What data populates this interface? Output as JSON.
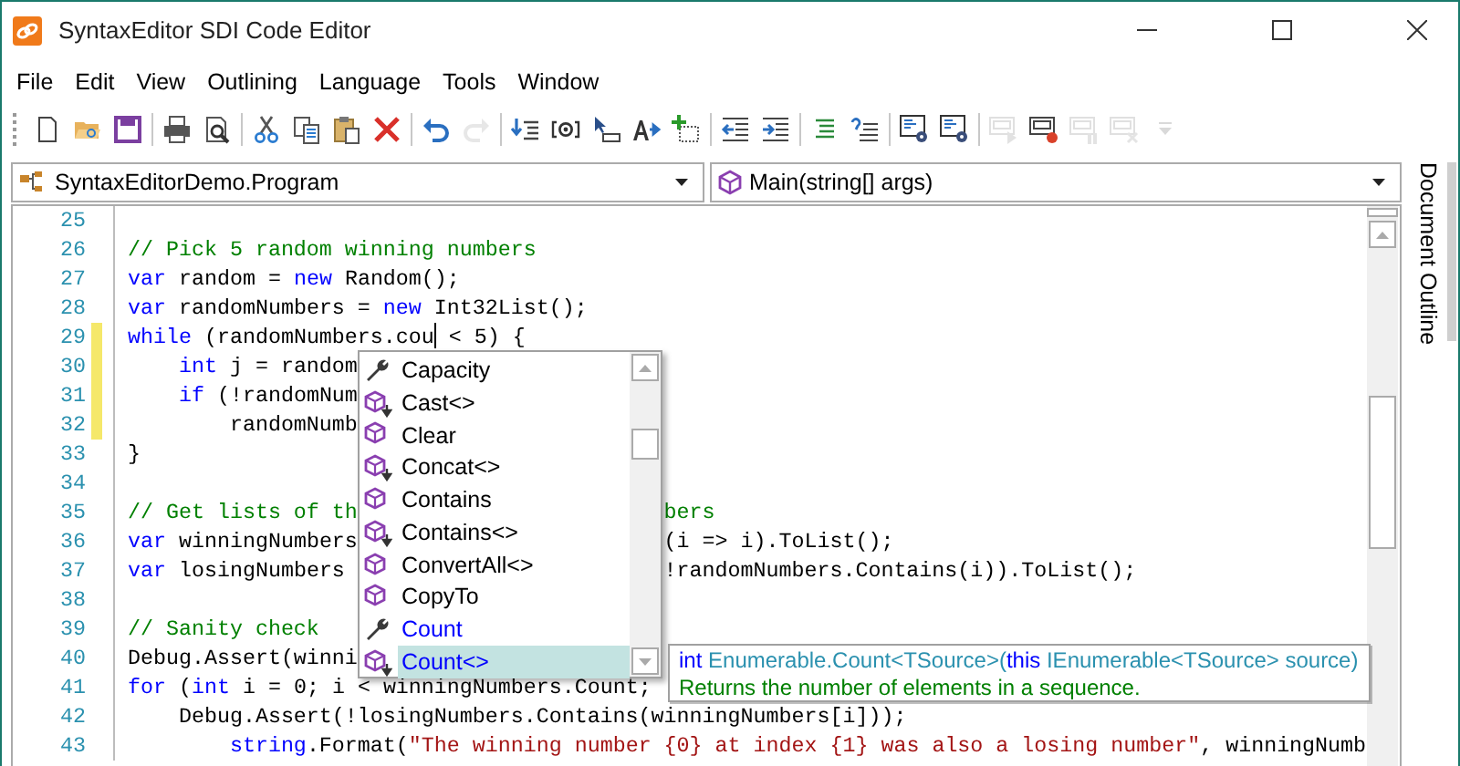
{
  "window": {
    "title": "SyntaxEditor SDI Code Editor"
  },
  "menu": [
    "File",
    "Edit",
    "View",
    "Outlining",
    "Language",
    "Tools",
    "Window"
  ],
  "toolbar": {
    "groups": [
      [
        {
          "kind": "new",
          "disabled": false
        },
        {
          "kind": "open",
          "disabled": false
        },
        {
          "kind": "save",
          "disabled": false
        }
      ],
      [
        {
          "kind": "print",
          "disabled": false
        },
        {
          "kind": "preview",
          "disabled": false
        }
      ],
      [
        {
          "kind": "cut",
          "disabled": false
        },
        {
          "kind": "copy",
          "disabled": false
        },
        {
          "kind": "paste",
          "disabled": false
        },
        {
          "kind": "delete",
          "disabled": false
        }
      ],
      [
        {
          "kind": "undo",
          "disabled": false
        },
        {
          "kind": "redo",
          "disabled": true
        }
      ],
      [
        {
          "kind": "list-arrow",
          "disabled": false
        },
        {
          "kind": "at-bracket",
          "disabled": false
        },
        {
          "kind": "pointer-box",
          "disabled": false
        },
        {
          "kind": "letter-arrow",
          "disabled": false
        },
        {
          "kind": "plus-box",
          "disabled": false
        }
      ],
      [
        {
          "kind": "outdent",
          "disabled": false
        },
        {
          "kind": "indent",
          "disabled": false
        }
      ],
      [
        {
          "kind": "lines",
          "disabled": false
        },
        {
          "kind": "lines-curl",
          "disabled": false
        }
      ],
      [
        {
          "kind": "doc-gear",
          "disabled": false
        },
        {
          "kind": "doc-gear",
          "disabled": false
        }
      ],
      [
        {
          "kind": "monitor-play",
          "disabled": true
        },
        {
          "kind": "monitor-record",
          "disabled": false
        },
        {
          "kind": "monitor-pause",
          "disabled": true
        },
        {
          "kind": "monitor-cross",
          "disabled": true
        },
        {
          "kind": "overflow",
          "disabled": true
        }
      ]
    ]
  },
  "type_combo": {
    "value": "SyntaxEditorDemo.Program"
  },
  "member_combo": {
    "value": "Main(string[] args)"
  },
  "side_tab": {
    "label": "Document Outline"
  },
  "editor": {
    "lines": [
      {
        "number": "25",
        "modified": false
      },
      {
        "number": "26",
        "modified": false,
        "tokens": [
          {
            "kind": "comment",
            "text": "// Pick 5 random winning numbers"
          }
        ]
      },
      {
        "number": "27",
        "modified": false,
        "tokens": [
          {
            "kind": "keyword",
            "text": "var"
          },
          {
            "kind": "plain",
            "text": " random = "
          },
          {
            "kind": "keyword",
            "text": "new"
          },
          {
            "kind": "plain",
            "text": " Random();"
          }
        ]
      },
      {
        "number": "28",
        "modified": false,
        "tokens": [
          {
            "kind": "keyword",
            "text": "var"
          },
          {
            "kind": "plain",
            "text": " randomNumbers = "
          },
          {
            "kind": "keyword",
            "text": "new"
          },
          {
            "kind": "plain",
            "text": " Int32List();"
          }
        ]
      },
      {
        "number": "29",
        "modified": true,
        "tokens": [
          {
            "kind": "keyword",
            "text": "while"
          },
          {
            "kind": "plain",
            "text": " (randomNumbers.cou"
          },
          {
            "kind": "caret"
          },
          {
            "kind": "plain",
            "text": " < 5) {"
          }
        ]
      },
      {
        "number": "30",
        "modified": true,
        "tokens": [
          {
            "kind": "keyword",
            "text": "    int"
          },
          {
            "kind": "plain",
            "text": " j = random"
          }
        ]
      },
      {
        "number": "31",
        "modified": true,
        "tokens": [
          {
            "kind": "keyword",
            "text": "    if"
          },
          {
            "kind": "plain",
            "text": " (!randomNum"
          }
        ]
      },
      {
        "number": "32",
        "modified": true,
        "tokens": [
          {
            "kind": "plain",
            "text": "        randomNumb"
          }
        ]
      },
      {
        "number": "33",
        "modified": false,
        "tokens": [
          {
            "kind": "plain",
            "text": "}"
          }
        ]
      },
      {
        "number": "34",
        "modified": false
      },
      {
        "number": "35",
        "modified": false,
        "tokens": [
          {
            "kind": "comment",
            "text": "// Get lists of th"
          }
        ],
        "tokens_after_popup": [
          {
            "kind": "comment",
            "text": "bers"
          }
        ]
      },
      {
        "number": "36",
        "modified": false,
        "tokens": [
          {
            "kind": "keyword",
            "text": "var"
          },
          {
            "kind": "plain",
            "text": " winningNumbers"
          }
        ],
        "tokens_after_popup": [
          {
            "kind": "plain",
            "text": "(i => i).ToList();"
          }
        ]
      },
      {
        "number": "37",
        "modified": false,
        "tokens": [
          {
            "kind": "keyword",
            "text": "var"
          },
          {
            "kind": "plain",
            "text": " losingNumbers"
          }
        ],
        "tokens_after_popup": [
          {
            "kind": "plain",
            "text": "!randomNumbers.Contains(i)).ToList();"
          }
        ]
      },
      {
        "number": "38",
        "modified": false
      },
      {
        "number": "39",
        "modified": false,
        "tokens": [
          {
            "kind": "comment",
            "text": "// Sanity check"
          }
        ]
      },
      {
        "number": "40",
        "modified": false,
        "tokens": [
          {
            "kind": "plain",
            "text": "Debug.Assert(winni"
          }
        ]
      },
      {
        "number": "41",
        "modified": false,
        "tokens": [
          {
            "kind": "keyword",
            "text": "for"
          },
          {
            "kind": "plain",
            "text": " ("
          },
          {
            "kind": "keyword",
            "text": "int"
          },
          {
            "kind": "plain",
            "text": " i = 0; i < winningNumbers.Count;"
          }
        ]
      },
      {
        "number": "42",
        "modified": false,
        "tokens": [
          {
            "kind": "plain",
            "text": "    Debug.Assert(!losingNumbers.Contains(winningNumbers[i]));"
          }
        ]
      },
      {
        "number": "43",
        "modified": false,
        "tokens": [
          {
            "kind": "keyword",
            "text": "        string"
          },
          {
            "kind": "plain",
            "text": ".Format("
          },
          {
            "kind": "string",
            "text": "\"The winning number {0} at index {1} was also a losing number\""
          },
          {
            "kind": "plain",
            "text": ", winningNumb"
          }
        ]
      }
    ]
  },
  "completion": {
    "items": [
      {
        "kind": "property",
        "label": "Capacity",
        "matched": false,
        "selected": false
      },
      {
        "kind": "extension",
        "label": "Cast<>",
        "matched": false,
        "selected": false
      },
      {
        "kind": "method",
        "label": "Clear",
        "matched": false,
        "selected": false
      },
      {
        "kind": "extension",
        "label": "Concat<>",
        "matched": false,
        "selected": false
      },
      {
        "kind": "method",
        "label": "Contains",
        "matched": false,
        "selected": false
      },
      {
        "kind": "extension",
        "label": "Contains<>",
        "matched": false,
        "selected": false
      },
      {
        "kind": "method",
        "label": "ConvertAll<>",
        "matched": false,
        "selected": false
      },
      {
        "kind": "method",
        "label": "CopyTo",
        "matched": false,
        "selected": false
      },
      {
        "kind": "property",
        "label": "Count",
        "matched": true,
        "selected": false
      },
      {
        "kind": "extension",
        "label": "Count<>",
        "matched": true,
        "selected": true
      }
    ]
  },
  "tooltip": {
    "signature": [
      {
        "kind": "keyword",
        "text": "int"
      },
      {
        "kind": "type",
        "text": " Enumerable.Count<TSource>("
      },
      {
        "kind": "keyword",
        "text": "this"
      },
      {
        "kind": "type",
        "text": " IEnumerable<TSource> source)"
      }
    ],
    "description": "Returns the number of elements in a sequence."
  }
}
